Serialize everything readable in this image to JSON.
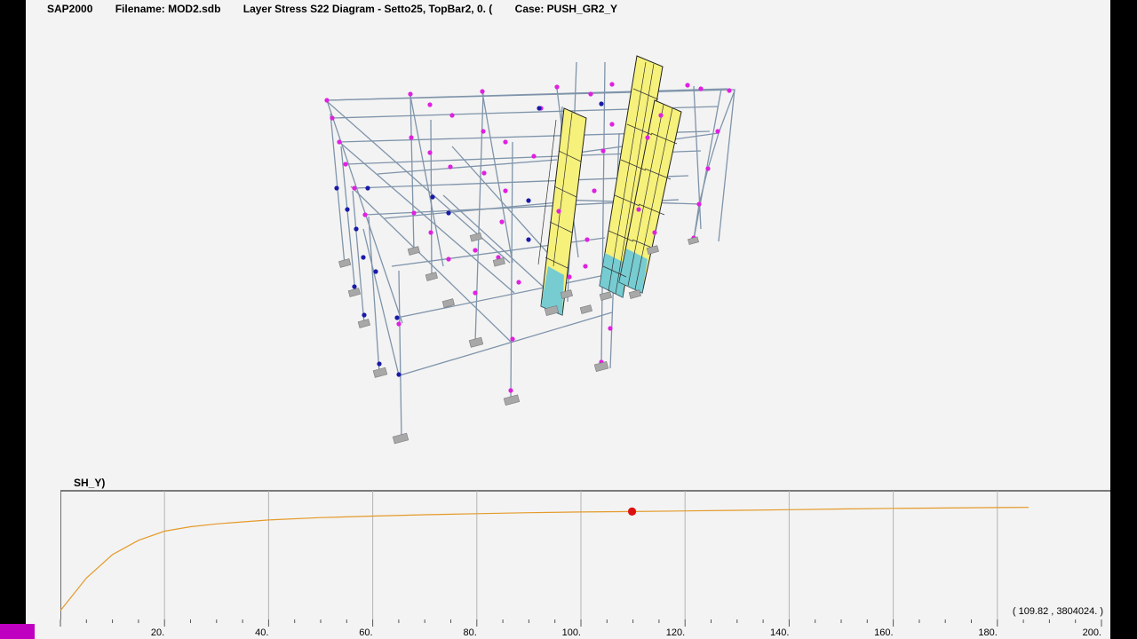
{
  "titlebar": {
    "program": "SAP2000",
    "filename": "Filename: MOD2.sdb",
    "diagram": "Layer Stress S22 Diagram - Setto25, TopBar2, 0.   (",
    "case": "Case: PUSH_GR2_Y"
  },
  "plot": {
    "title_fragment": "SH_Y)",
    "readout": "( 109.82 , 3804024. )",
    "x_tick_labels": [
      "20.",
      "40.",
      "60.",
      "80.",
      "100.",
      "120.",
      "140.",
      "160.",
      "180.",
      "200."
    ],
    "colors": {
      "curve": "#e49a2a",
      "marker": "#dd1111",
      "grid": "#b4b4b4",
      "progress": "#c000c0"
    }
  },
  "chart_data": {
    "type": "line",
    "title": "",
    "xlabel": "",
    "ylabel": "",
    "xlim": [
      0,
      200
    ],
    "x_ticks": [
      20,
      40,
      60,
      80,
      100,
      120,
      140,
      160,
      180,
      200
    ],
    "grid": true,
    "series": [
      {
        "x": [
          0,
          5,
          10,
          15,
          20,
          25,
          30,
          40,
          50,
          60,
          70,
          80,
          90,
          100,
          109.82,
          120,
          130,
          140,
          150,
          160,
          170,
          180,
          186
        ],
        "y": [
          0,
          1250000,
          2150000,
          2700000,
          3050000,
          3220000,
          3330000,
          3480000,
          3570000,
          3630000,
          3680000,
          3720000,
          3760000,
          3785000,
          3804024,
          3825000,
          3850000,
          3875000,
          3900000,
          3925000,
          3940000,
          3955000,
          3962000
        ]
      }
    ],
    "highlight_point": {
      "x": 109.82,
      "y": 3804024
    }
  },
  "model": {
    "colors": {
      "frame": "#7f94aa",
      "joint": "#e020e0",
      "hinge": "#1a1aa8",
      "wall_fill": "#f6f17a",
      "wall_grid": "#333333",
      "support": "#a8a8a8"
    }
  }
}
